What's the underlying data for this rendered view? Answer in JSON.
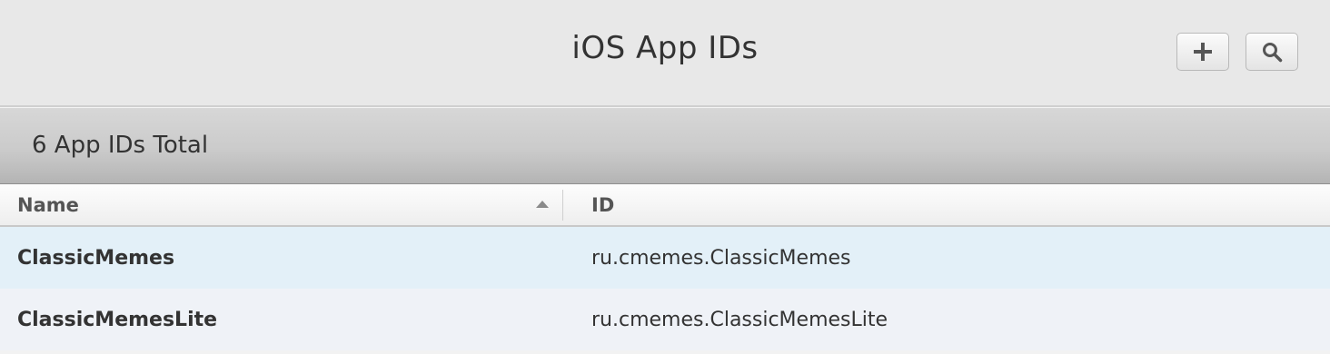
{
  "header": {
    "title": "iOS App IDs",
    "add_icon": "plus-icon",
    "search_icon": "magnifier-icon"
  },
  "summary": {
    "text": "6 App IDs Total"
  },
  "table": {
    "columns": [
      {
        "label": "Name",
        "sorted": "ascending"
      },
      {
        "label": "ID"
      }
    ],
    "rows": [
      {
        "name": "ClassicMemes",
        "id": "ru.cmemes.ClassicMemes"
      },
      {
        "name": "ClassicMemesLite",
        "id": "ru.cmemes.ClassicMemesLite"
      }
    ]
  },
  "colors": {
    "row_selected": "#e3f0f8",
    "row_alt": "#eff2f7",
    "header_bg": "#e8e8e8"
  }
}
